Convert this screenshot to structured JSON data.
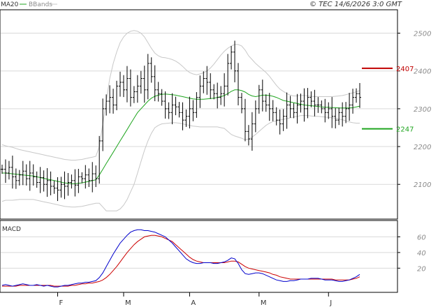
{
  "header": {
    "ma_legend": "MA20",
    "bb_legend": "BBands",
    "copyright": "© TEC 14/6/2026 3:0 GMT"
  },
  "colors": {
    "price": "#000000",
    "ma": "#1fa51f",
    "bbands": "#c8c8c8",
    "resistance": "#c00000",
    "support": "#1fa51f",
    "macd": "#0000cc",
    "signal": "#cc0000",
    "grid": "#d9d9d9"
  },
  "chart_data": [
    {
      "type": "ohlc",
      "ylim": [
        2010,
        2560
      ],
      "ytick_labels": [
        "2500",
        "2400",
        "2300",
        "2200",
        "2100"
      ],
      "yticks": [
        2500,
        2400,
        2300,
        2200,
        2100
      ],
      "x_labels": [
        "F",
        "M",
        "A",
        "M",
        "J"
      ],
      "x_label_index": [
        16,
        35,
        54,
        74,
        94
      ],
      "n_bars": 104,
      "close": [
        2140,
        2130,
        2145,
        2120,
        2110,
        2125,
        2135,
        2115,
        2130,
        2120,
        2105,
        2118,
        2100,
        2110,
        2095,
        2090,
        2085,
        2100,
        2095,
        2105,
        2110,
        2098,
        2120,
        2115,
        2125,
        2110,
        2128,
        2115,
        2215,
        2300,
        2320,
        2330,
        2310,
        2360,
        2370,
        2350,
        2380,
        2330,
        2345,
        2360,
        2380,
        2350,
        2420,
        2385,
        2350,
        2340,
        2320,
        2300,
        2290,
        2310,
        2305,
        2290,
        2270,
        2280,
        2300,
        2290,
        2330,
        2360,
        2380,
        2370,
        2350,
        2340,
        2330,
        2340,
        2360,
        2420,
        2450,
        2400,
        2330,
        2300,
        2240,
        2220,
        2260,
        2300,
        2350,
        2320,
        2310,
        2300,
        2290,
        2270,
        2260,
        2280,
        2310,
        2300,
        2290,
        2310,
        2320,
        2300,
        2330,
        2320,
        2310,
        2310,
        2300,
        2290,
        2300,
        2280,
        2270,
        2290,
        2280,
        2300,
        2310,
        2330,
        2340,
        2330
      ],
      "ma20": [
        2130,
        2130,
        2129,
        2128,
        2127,
        2126,
        2125,
        2124,
        2123,
        2122,
        2120,
        2118,
        2116,
        2114,
        2112,
        2110,
        2108,
        2106,
        2104,
        2103,
        2102,
        2102,
        2103,
        2104,
        2106,
        2108,
        2110,
        2112,
        2125,
        2140,
        2155,
        2170,
        2185,
        2200,
        2215,
        2230,
        2245,
        2260,
        2275,
        2290,
        2300,
        2310,
        2320,
        2328,
        2333,
        2336,
        2338,
        2339,
        2338,
        2337,
        2336,
        2334,
        2332,
        2330,
        2328,
        2326,
        2325,
        2325,
        2325,
        2326,
        2327,
        2328,
        2330,
        2332,
        2335,
        2340,
        2346,
        2350,
        2350,
        2348,
        2344,
        2338,
        2334,
        2332,
        2334,
        2336,
        2336,
        2335,
        2333,
        2330,
        2326,
        2322,
        2320,
        2318,
        2316,
        2314,
        2312,
        2310,
        2309,
        2308,
        2307,
        2306,
        2305,
        2304,
        2304,
        2303,
        2303,
        2302,
        2302,
        2302,
        2302,
        2303,
        2305,
        2307
      ],
      "bb_upper": [
        2205,
        2202,
        2200,
        2198,
        2195,
        2192,
        2190,
        2188,
        2186,
        2184,
        2182,
        2180,
        2178,
        2176,
        2174,
        2172,
        2170,
        2168,
        2166,
        2165,
        2164,
        2164,
        2165,
        2166,
        2168,
        2170,
        2172,
        2174,
        2200,
        2260,
        2320,
        2380,
        2420,
        2450,
        2475,
        2490,
        2500,
        2505,
        2507,
        2505,
        2500,
        2490,
        2475,
        2460,
        2447,
        2440,
        2436,
        2435,
        2433,
        2430,
        2426,
        2420,
        2412,
        2403,
        2396,
        2392,
        2390,
        2392,
        2395,
        2400,
        2408,
        2418,
        2430,
        2442,
        2452,
        2460,
        2466,
        2470,
        2470,
        2466,
        2455,
        2440,
        2430,
        2420,
        2412,
        2404,
        2396,
        2386,
        2374,
        2362,
        2352,
        2346,
        2340,
        2336,
        2334,
        2334,
        2335,
        2335,
        2334,
        2333,
        2332,
        2332,
        2332,
        2332,
        2332,
        2332,
        2333,
        2334,
        2335,
        2337,
        2340,
        2342,
        2345,
        2348
      ],
      "bb_lower": [
        2055,
        2058,
        2058,
        2058,
        2059,
        2060,
        2060,
        2060,
        2060,
        2060,
        2058,
        2056,
        2054,
        2052,
        2050,
        2048,
        2046,
        2044,
        2042,
        2041,
        2040,
        2040,
        2041,
        2042,
        2044,
        2046,
        2048,
        2050,
        2050,
        2040,
        2030,
        2030,
        2030,
        2030,
        2035,
        2045,
        2060,
        2080,
        2100,
        2130,
        2160,
        2190,
        2215,
        2235,
        2250,
        2256,
        2260,
        2261,
        2262,
        2263,
        2263,
        2262,
        2260,
        2258,
        2256,
        2254,
        2253,
        2252,
        2252,
        2252,
        2252,
        2252,
        2252,
        2250,
        2248,
        2240,
        2232,
        2228,
        2225,
        2222,
        2218,
        2220,
        2225,
        2232,
        2240,
        2248,
        2256,
        2262,
        2266,
        2268,
        2270,
        2272,
        2274,
        2276,
        2278,
        2280,
        2282,
        2282,
        2282,
        2281,
        2280,
        2280,
        2279,
        2278,
        2277,
        2276,
        2275,
        2273,
        2271,
        2268,
        2265,
        2263,
        2262,
        2262
      ],
      "levels": [
        {
          "value": 2407,
          "label": "2407",
          "color": "#c00000"
        },
        {
          "value": 2247,
          "label": "2247",
          "color": "#1fa51f"
        }
      ]
    },
    {
      "type": "line",
      "title": "MACD",
      "ylim": [
        -10,
        80
      ],
      "ytick_labels": [
        "60",
        "40",
        "20"
      ],
      "yticks": [
        60,
        40,
        20
      ],
      "series": [
        {
          "values": [
            -2,
            -1,
            -2,
            -3,
            -2,
            -1,
            0,
            -1,
            -2,
            -2,
            -1,
            -2,
            -3,
            -2,
            -3,
            -4,
            -4,
            -3,
            -2,
            -2,
            -1,
            0,
            1,
            1,
            2,
            2,
            3,
            4,
            8,
            14,
            22,
            30,
            38,
            45,
            52,
            57,
            62,
            66,
            68,
            69,
            69,
            68,
            68,
            67,
            66,
            64,
            62,
            60,
            56,
            52,
            47,
            42,
            37,
            32,
            29,
            27,
            26,
            26,
            27,
            27,
            27,
            26,
            26,
            27,
            28,
            30,
            33,
            32,
            26,
            18,
            13,
            12,
            13,
            14,
            14,
            13,
            11,
            9,
            7,
            5,
            4,
            3,
            3,
            4,
            4,
            5,
            6,
            6,
            6,
            7,
            7,
            7,
            6,
            5,
            5,
            5,
            4,
            3,
            3,
            4,
            5,
            7,
            9,
            12
          ]
        },
        {
          "values": [
            -3,
            -3,
            -3,
            -3,
            -3,
            -2,
            -2,
            -2,
            -2,
            -2,
            -2,
            -2,
            -2,
            -2,
            -2,
            -3,
            -3,
            -3,
            -3,
            -3,
            -2,
            -2,
            -1,
            0,
            0,
            1,
            1,
            2,
            3,
            5,
            8,
            12,
            17,
            22,
            28,
            34,
            40,
            45,
            50,
            54,
            57,
            60,
            61,
            62,
            62,
            61,
            60,
            58,
            56,
            54,
            50,
            46,
            42,
            38,
            34,
            31,
            29,
            28,
            27,
            27,
            27,
            27,
            27,
            27,
            27,
            28,
            29,
            29,
            28,
            25,
            22,
            20,
            19,
            18,
            17,
            16,
            15,
            14,
            12,
            11,
            9,
            8,
            7,
            6,
            6,
            6,
            6,
            6,
            6,
            6,
            6,
            6,
            6,
            6,
            6,
            6,
            5,
            5,
            5,
            5,
            5,
            6,
            7,
            9
          ]
        }
      ]
    }
  ]
}
